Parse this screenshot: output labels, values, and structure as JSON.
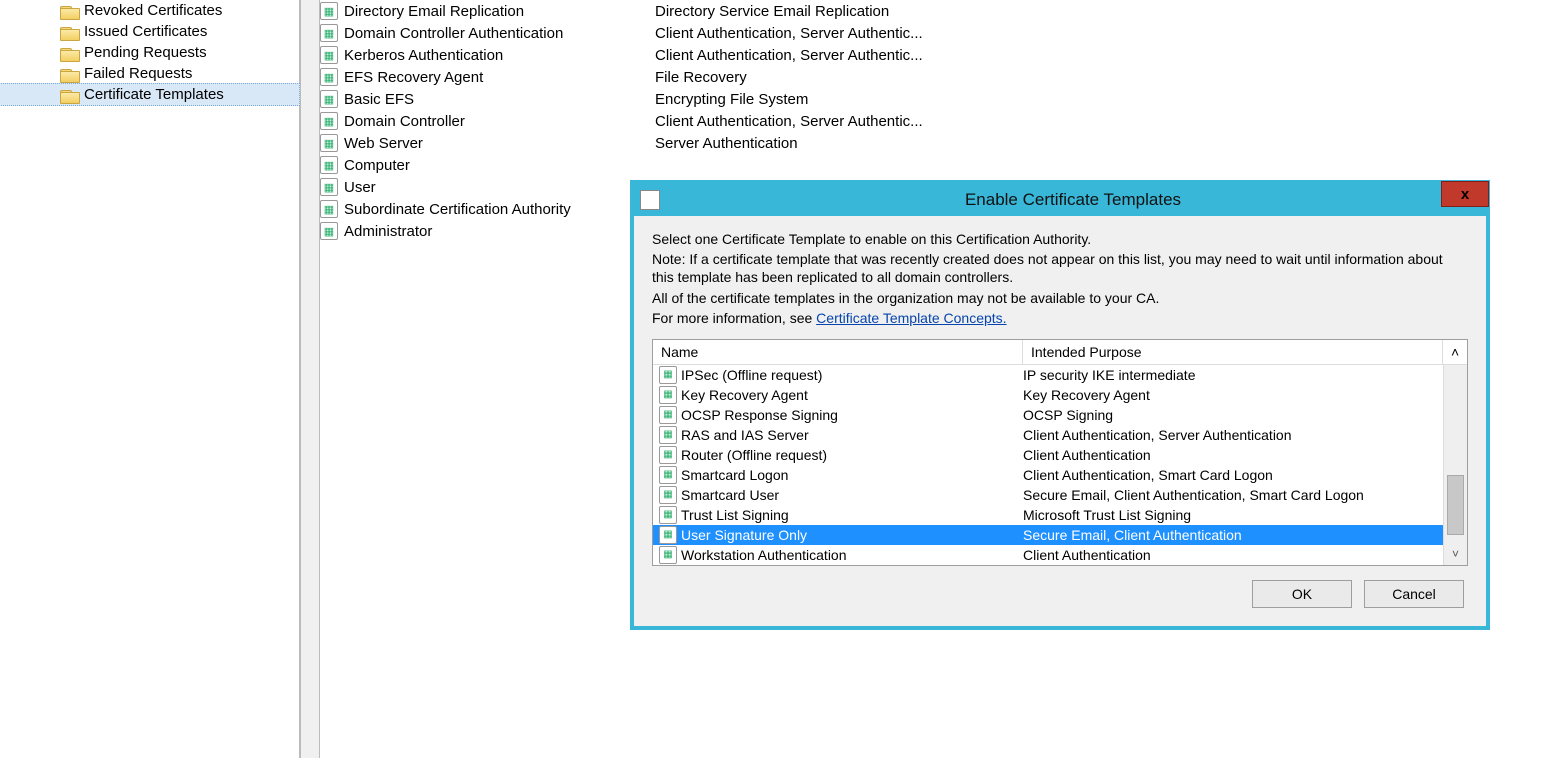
{
  "tree": {
    "items": [
      {
        "label": "Revoked Certificates",
        "selected": false
      },
      {
        "label": "Issued Certificates",
        "selected": false
      },
      {
        "label": "Pending Requests",
        "selected": false
      },
      {
        "label": "Failed Requests",
        "selected": false
      },
      {
        "label": "Certificate Templates",
        "selected": true
      }
    ]
  },
  "content": {
    "rows": [
      {
        "name": "Directory Email Replication",
        "purpose": "Directory Service Email Replication"
      },
      {
        "name": "Domain Controller Authentication",
        "purpose": "Client Authentication, Server Authentic..."
      },
      {
        "name": "Kerberos Authentication",
        "purpose": "Client Authentication, Server Authentic..."
      },
      {
        "name": "EFS Recovery Agent",
        "purpose": "File Recovery"
      },
      {
        "name": "Basic EFS",
        "purpose": "Encrypting File System"
      },
      {
        "name": "Domain Controller",
        "purpose": "Client Authentication, Server Authentic..."
      },
      {
        "name": "Web Server",
        "purpose": "Server Authentication"
      },
      {
        "name": "Computer",
        "purpose": ""
      },
      {
        "name": "User",
        "purpose": ""
      },
      {
        "name": "Subordinate Certification Authority",
        "purpose": ""
      },
      {
        "name": "Administrator",
        "purpose": ""
      }
    ]
  },
  "dialog": {
    "title": "Enable Certificate Templates",
    "instruction1": "Select one Certificate Template to enable on this Certification Authority.",
    "note": "Note: If a certificate template that was recently created does not appear on this list, you may need to wait until information about this template has been replicated to all domain controllers.",
    "instruction2": "All of the certificate templates in the organization may not be available to your CA.",
    "more_info_prefix": "For more information, see ",
    "more_info_link": "Certificate Template Concepts.",
    "columns": {
      "name": "Name",
      "purpose": "Intended Purpose"
    },
    "rows": [
      {
        "name": "IPSec (Offline request)",
        "purpose": "IP security IKE intermediate",
        "selected": false
      },
      {
        "name": "Key Recovery Agent",
        "purpose": "Key Recovery Agent",
        "selected": false
      },
      {
        "name": "OCSP Response Signing",
        "purpose": "OCSP Signing",
        "selected": false
      },
      {
        "name": "RAS and IAS Server",
        "purpose": "Client Authentication, Server Authentication",
        "selected": false
      },
      {
        "name": "Router (Offline request)",
        "purpose": "Client Authentication",
        "selected": false
      },
      {
        "name": "Smartcard Logon",
        "purpose": "Client Authentication, Smart Card Logon",
        "selected": false
      },
      {
        "name": "Smartcard User",
        "purpose": "Secure Email, Client Authentication, Smart Card Logon",
        "selected": false
      },
      {
        "name": "Trust List Signing",
        "purpose": "Microsoft Trust List Signing",
        "selected": false
      },
      {
        "name": "User Signature Only",
        "purpose": "Secure Email, Client Authentication",
        "selected": true
      },
      {
        "name": "Workstation Authentication",
        "purpose": "Client Authentication",
        "selected": false
      }
    ],
    "buttons": {
      "ok": "OK",
      "cancel": "Cancel"
    },
    "close": "x"
  }
}
